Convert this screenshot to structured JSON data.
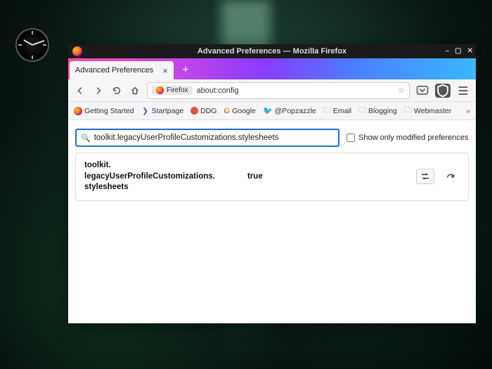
{
  "window": {
    "title": "Advanced Preferences — Mozilla Firefox"
  },
  "tabs": {
    "active": {
      "label": "Advanced Preferences"
    }
  },
  "urlbar": {
    "context_label": "Firefox",
    "url": "about:config"
  },
  "bookmarks": [
    {
      "label": "Getting Started",
      "icon": "firefox"
    },
    {
      "label": "Startpage",
      "icon": "startpage"
    },
    {
      "label": "DDG",
      "icon": "ddg"
    },
    {
      "label": "Google",
      "icon": "google"
    },
    {
      "label": "@Popzazzle",
      "icon": "twitter"
    },
    {
      "label": "Email",
      "icon": "folder"
    },
    {
      "label": "Blogging",
      "icon": "folder"
    },
    {
      "label": "Webmaster",
      "icon": "folder"
    }
  ],
  "aboutconfig": {
    "search_value": "toolkit.legacyUserProfileCustomizations.stylesheets",
    "show_modified_label": "Show only modified preferences",
    "show_modified_checked": false,
    "result": {
      "pref_name": "toolkit.\nlegacyUserProfileCustomizations.\nstylesheets",
      "pref_value": "true"
    }
  }
}
